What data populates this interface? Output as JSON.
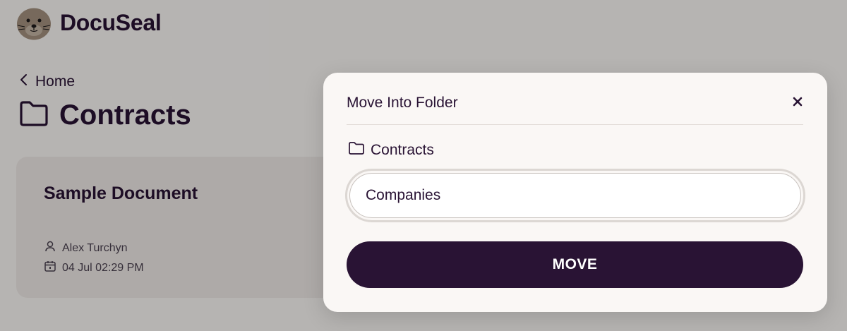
{
  "app": {
    "brand": "DocuSeal",
    "logo_icon": "seal-logo-icon"
  },
  "nav": {
    "back_label": "Home",
    "back_icon": "chevron-left-icon"
  },
  "page": {
    "title": "Contracts",
    "title_icon": "folder-icon"
  },
  "document_card": {
    "title": "Sample Document",
    "author": "Alex Turchyn",
    "author_icon": "user-icon",
    "date": "04 Jul 02:29 PM",
    "date_icon": "calendar-icon"
  },
  "modal": {
    "title": "Move Into Folder",
    "close_icon": "close-icon",
    "current_folder": "Contracts",
    "current_folder_icon": "folder-icon",
    "folder_input_value": "Companies",
    "move_label": "MOVE"
  },
  "colors": {
    "primary": "#291334",
    "background": "#faf7f5",
    "card": "#efeae6"
  }
}
